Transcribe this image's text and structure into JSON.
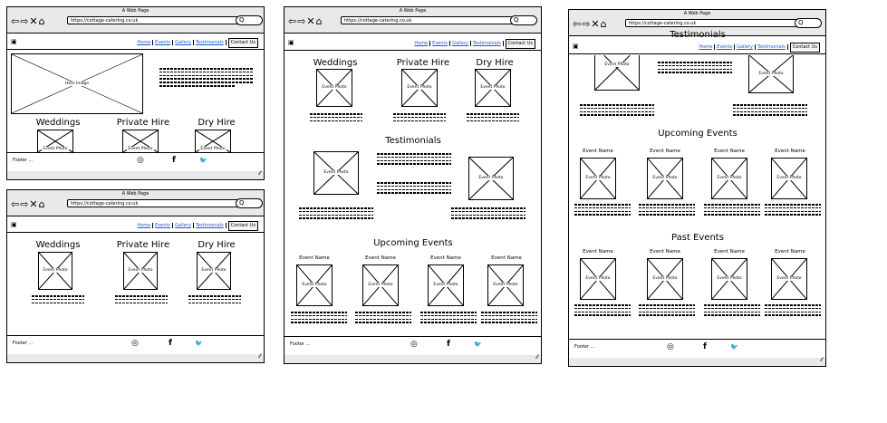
{
  "window": {
    "title": "A Web Page",
    "url": "https://cottage-catering.co.uk",
    "go": "Q",
    "nav_icons": "⇦⇨✕⌂",
    "resize": "⁄⁄"
  },
  "nav": {
    "logo": "▣",
    "links": [
      "Home",
      "Events",
      "Gallery",
      "Testimonials"
    ],
    "cta": "Contact Us"
  },
  "hero": {
    "caption": "Hero Image"
  },
  "services": [
    "Weddings",
    "Private Hire",
    "Dry Hire"
  ],
  "photo_caption": "Event Photo",
  "sections": {
    "testimonials": "Testimonials",
    "upcoming": "Upcoming Events",
    "past": "Past Events"
  },
  "event_name": "Event Name",
  "footer": {
    "text": "Footer  ...",
    "icons": {
      "instagram": "◎",
      "facebook": "f",
      "twitter": "🐦"
    }
  }
}
